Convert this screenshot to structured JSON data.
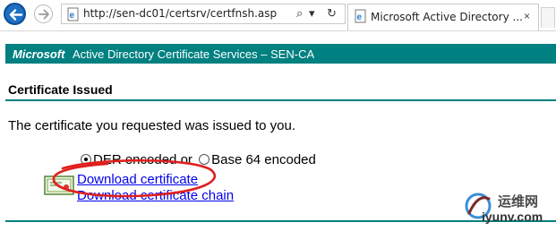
{
  "browser": {
    "url": "http://sen-dc01/certsrv/certfnsh.asp",
    "tab_title": "Microsoft Active Directory ...",
    "tab_close": "×",
    "search_glyph": "⌕",
    "dropdown_glyph": "▾",
    "refresh_glyph": "↻",
    "icons": [
      "back-arrow",
      "forward-arrow",
      "ie-page",
      "search",
      "refresh",
      "close"
    ]
  },
  "banner": {
    "brand": "Microsoft",
    "text": "Active Directory Certificate Services  –  SEN-CA"
  },
  "page": {
    "heading": "Certificate Issued",
    "message": "The certificate you requested was issued to you.",
    "encoding": {
      "der_label": "DER encoded",
      "or_text": "or",
      "base64_label": "Base 64 encoded",
      "selected": "DER encoded"
    },
    "links": {
      "download_certificate": "Download certificate",
      "download_chain": "Download certificate chain"
    }
  },
  "watermark": {
    "line1": "运维网",
    "line2": "iyunv.com"
  },
  "colors": {
    "banner": "#008080",
    "link": "#0000ee",
    "annotation": "#e0201e",
    "back_button": "#1f6fc5"
  }
}
